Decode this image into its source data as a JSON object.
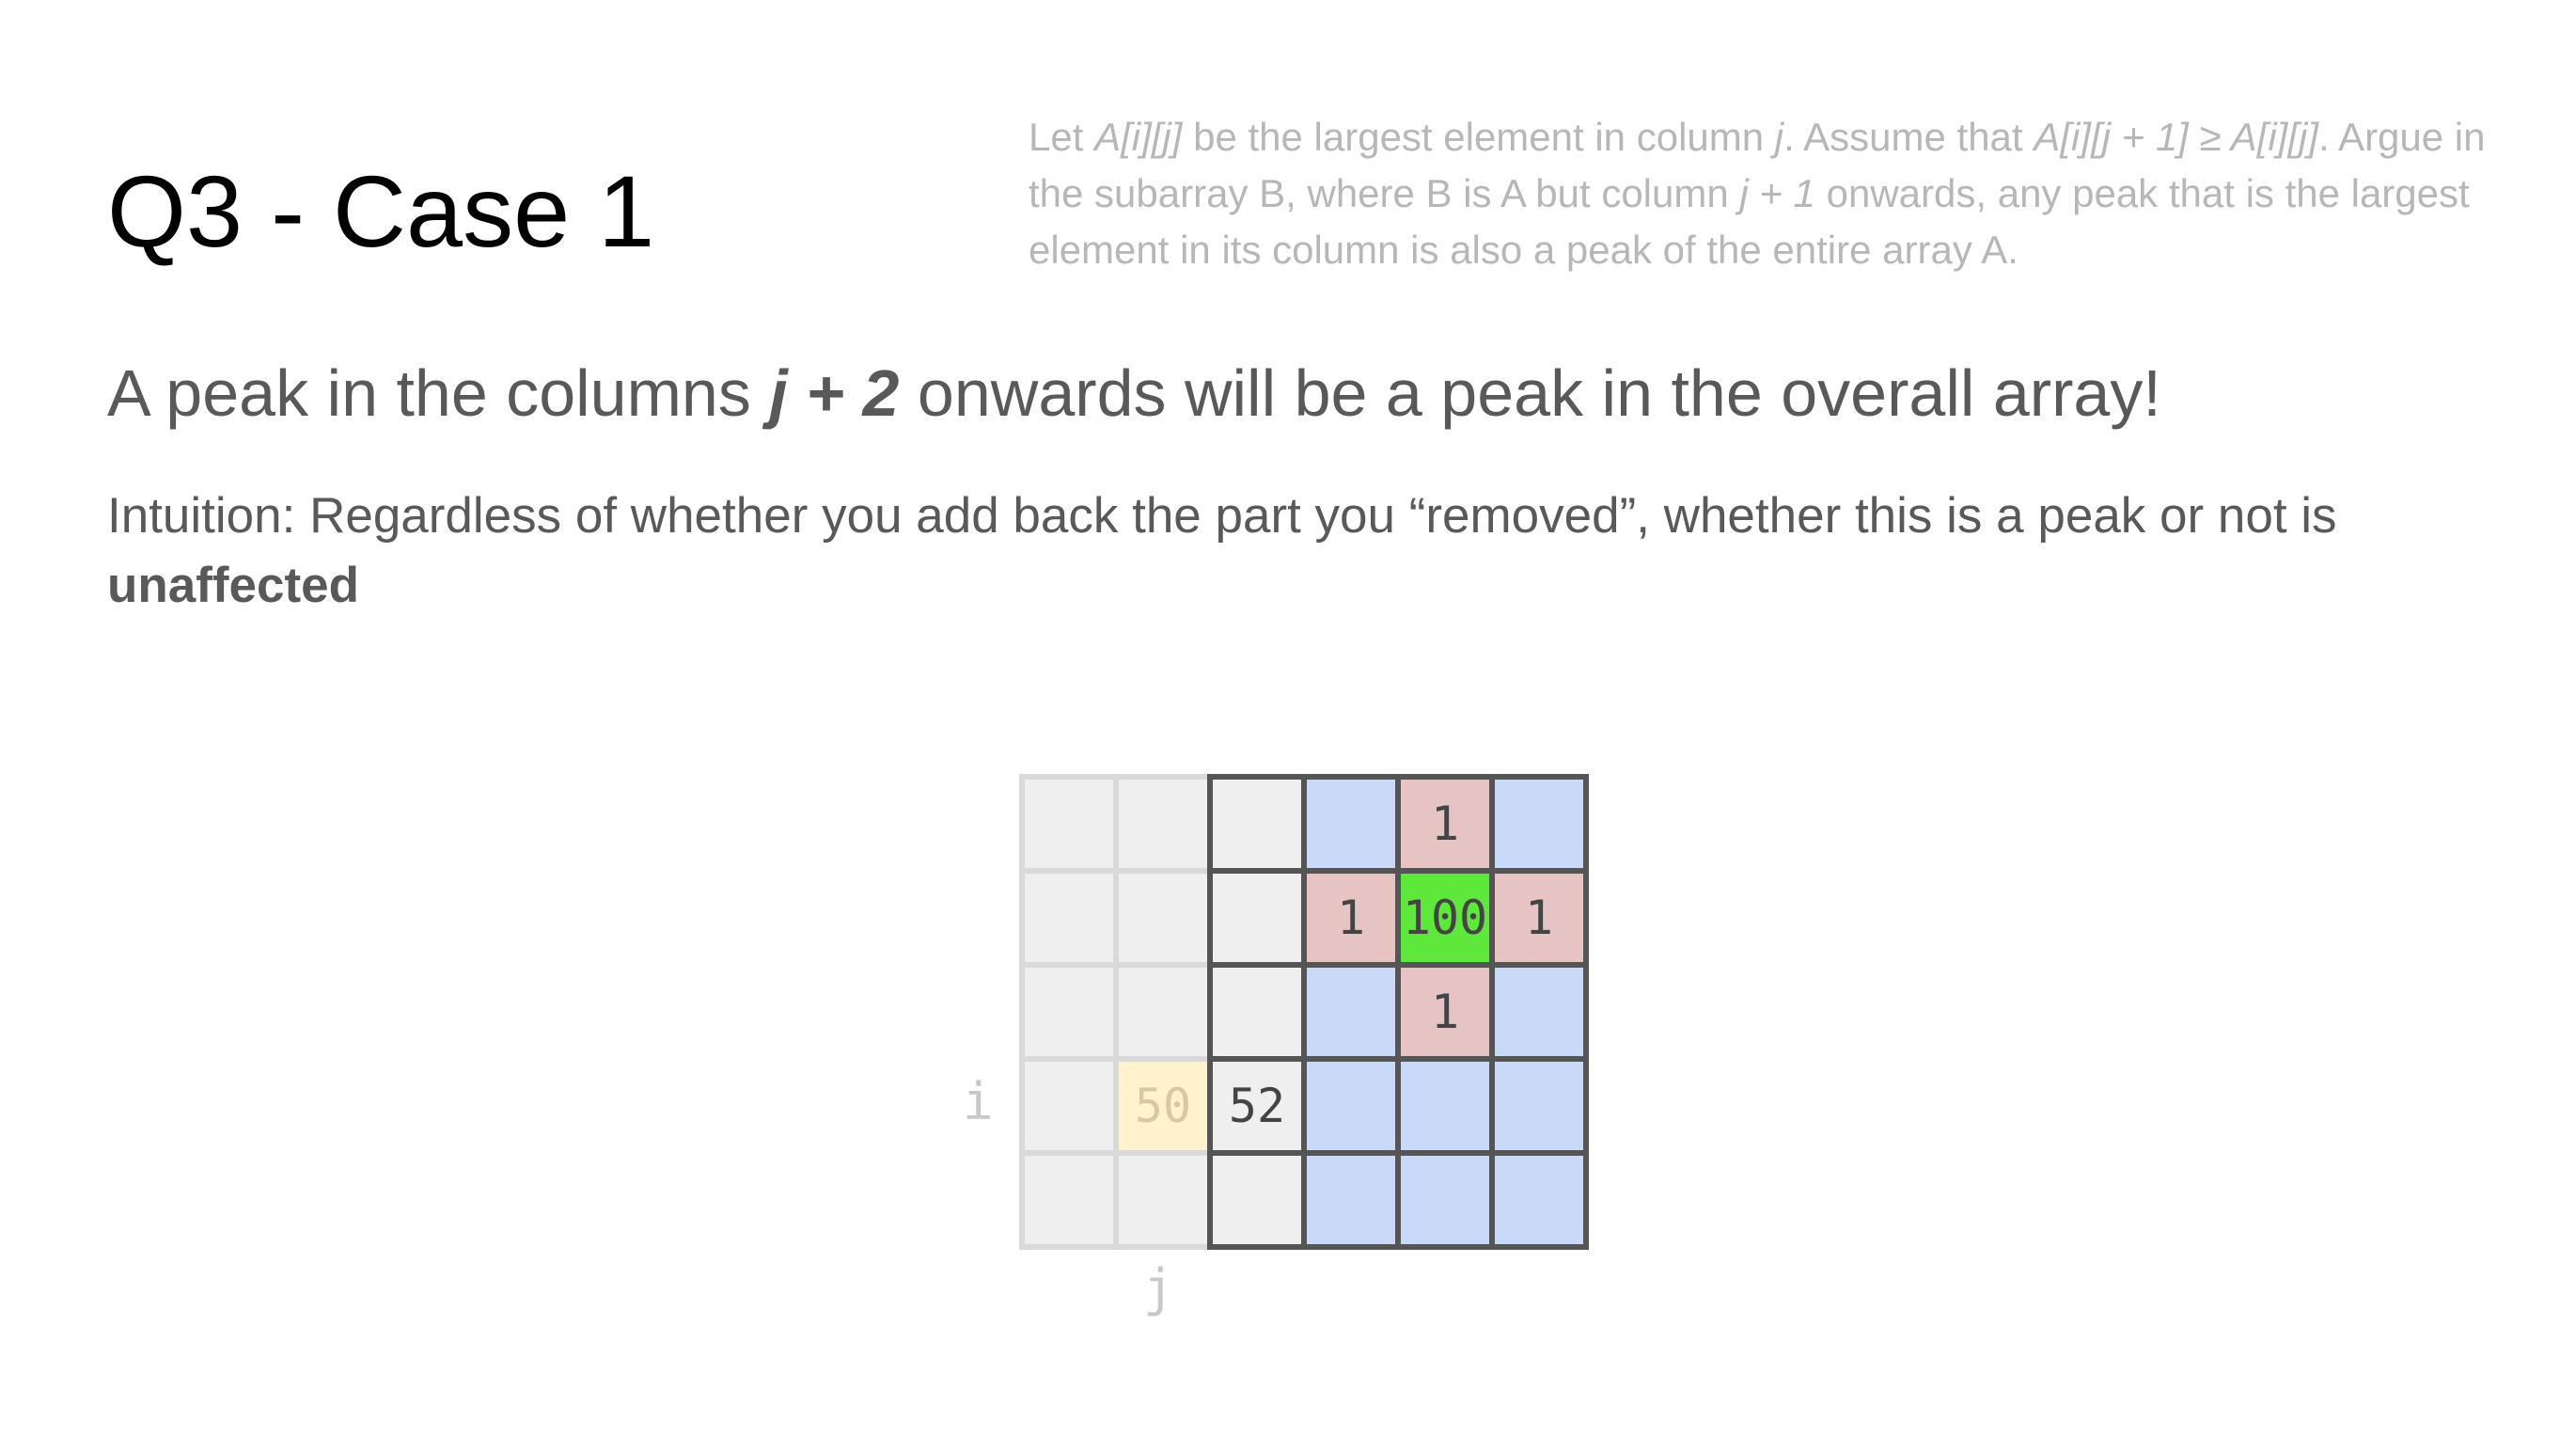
{
  "slide": {
    "title": "Q3 - Case 1",
    "note": {
      "t1": "Let ",
      "t2": "A[i][j]",
      "t3": " be the largest element in column ",
      "t4": "j",
      "t5": ". Assume that ",
      "t6": "A[i][j + 1] ≥ A[i][j]",
      "t7": ". Argue in the subarray B, where B is A but column ",
      "t8": "j + 1",
      "t9": " onwards, any peak that is the largest element in its column is also a peak of the entire array A."
    },
    "heading": {
      "pre": "A peak in the columns ",
      "var": "j + 2",
      "post": " onwards will be a peak in the overall array!"
    },
    "intuition": {
      "text": "Intuition: Regardless of whether you add back the part you “removed”, whether this is a peak or not is ",
      "bold": "unaffected"
    }
  },
  "grid": {
    "rows": 5,
    "cols": 6,
    "row_label": "i",
    "col_label": "j",
    "cells": [
      [
        "",
        "",
        "",
        "",
        "1",
        ""
      ],
      [
        "",
        "",
        "",
        "1",
        "100",
        "1"
      ],
      [
        "",
        "",
        "",
        "",
        "1",
        ""
      ],
      [
        "",
        "50",
        "52",
        "",
        "",
        ""
      ],
      [
        "",
        "",
        "",
        "",
        "",
        ""
      ]
    ],
    "fills": [
      [
        "faded",
        "faded",
        "plain",
        "blue",
        "pink",
        "blue"
      ],
      [
        "faded",
        "faded",
        "plain",
        "pink",
        "green",
        "pink"
      ],
      [
        "faded",
        "faded",
        "plain",
        "blue",
        "pink",
        "blue"
      ],
      [
        "faded",
        "yellow",
        "plain",
        "blue",
        "blue",
        "blue"
      ],
      [
        "faded",
        "faded",
        "plain",
        "blue",
        "blue",
        "blue"
      ]
    ],
    "colors": {
      "faded": "#efefef",
      "faded_border": "#d9d9d9",
      "plain": "#efefef",
      "blue": "#c9daf8",
      "pink": "#e6c4c4",
      "green": "#5fe83c",
      "yellow": "#fff2cc",
      "border": "#555555",
      "faded_text": "#d7c9a0"
    }
  }
}
